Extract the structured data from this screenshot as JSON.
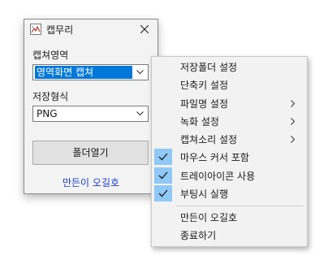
{
  "window": {
    "title": "캡무리",
    "capture_area_label": "캡쳐영역",
    "capture_area_value": "영역화면 캡쳐",
    "save_format_label": "저장형식",
    "save_format_value": "PNG",
    "open_folder_label": "폴더열기",
    "maker_link": "만든이 오길호"
  },
  "menu": {
    "items": [
      {
        "label": "저장폴더 설정",
        "submenu": false,
        "checked": false
      },
      {
        "label": "단축키 설정",
        "submenu": false,
        "checked": false
      },
      {
        "label": "파일명 설정",
        "submenu": true,
        "checked": false
      },
      {
        "label": "녹화 설정",
        "submenu": true,
        "checked": false
      },
      {
        "label": "캡쳐소리 설정",
        "submenu": true,
        "checked": false
      },
      {
        "label": "마우스 커서 포함",
        "submenu": false,
        "checked": true
      },
      {
        "label": "트레이아이콘 사용",
        "submenu": false,
        "checked": true
      },
      {
        "label": "부팅시 실행",
        "submenu": false,
        "checked": true
      },
      {
        "label": "만든이 오길호",
        "submenu": false,
        "checked": false
      },
      {
        "label": "종료하기",
        "submenu": false,
        "checked": false
      }
    ]
  },
  "colors": {
    "selection": "#0078d7",
    "check_highlight": "#90c8f6",
    "link": "#1a3cc7"
  }
}
